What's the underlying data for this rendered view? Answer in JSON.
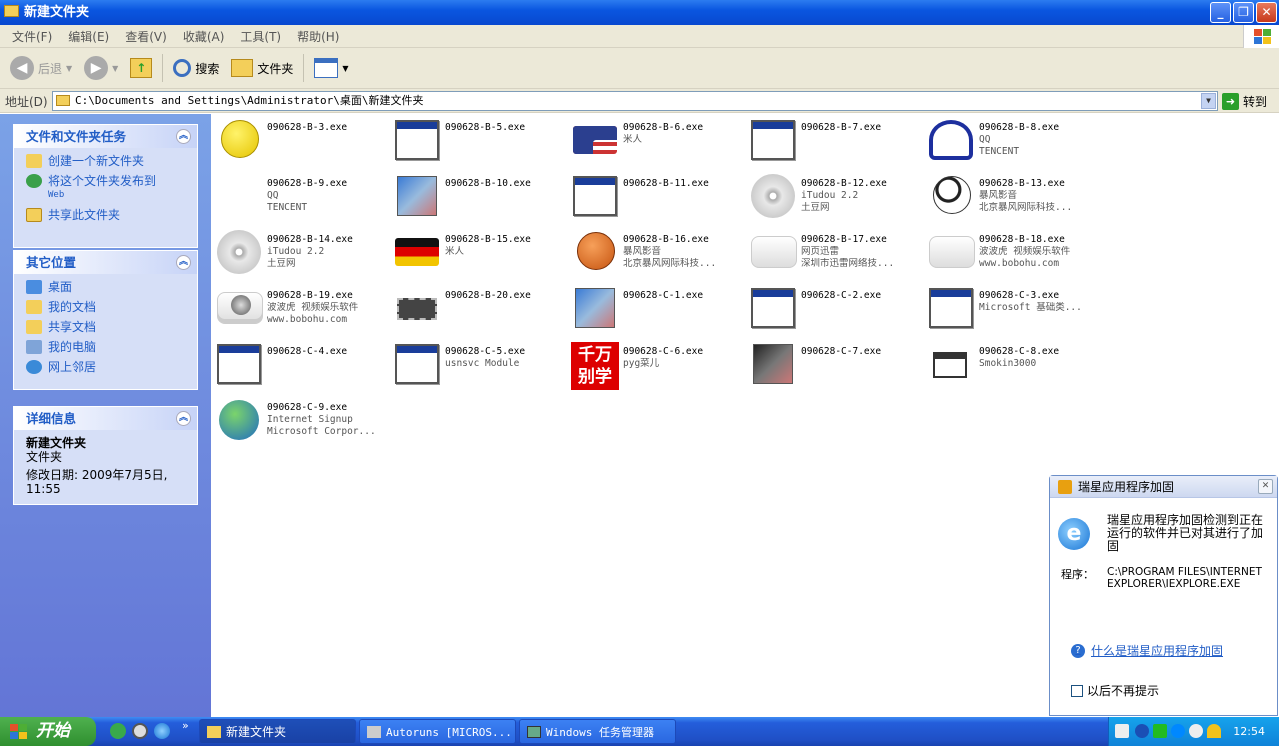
{
  "window": {
    "title": "新建文件夹",
    "btn_min": "_",
    "btn_max": "❐",
    "btn_close": "✕"
  },
  "menu": [
    "文件(F)",
    "编辑(E)",
    "查看(V)",
    "收藏(A)",
    "工具(T)",
    "帮助(H)"
  ],
  "toolbar": {
    "back": "后退",
    "search": "搜索",
    "folders": "文件夹"
  },
  "address": {
    "label": "地址(D)",
    "path": "C:\\Documents and Settings\\Administrator\\桌面\\新建文件夹",
    "go": "转到"
  },
  "tasks": {
    "title": "文件和文件夹任务",
    "items": [
      {
        "label": "创建一个新文件夹",
        "sub": ""
      },
      {
        "label": "将这个文件夹发布到",
        "sub": "Web"
      },
      {
        "label": "共享此文件夹",
        "sub": ""
      }
    ]
  },
  "places": {
    "title": "其它位置",
    "items": [
      "桌面",
      "我的文档",
      "共享文档",
      "我的电脑",
      "网上邻居"
    ]
  },
  "details": {
    "title": "详细信息",
    "name": "新建文件夹",
    "type": "文件夹",
    "modified": "修改日期: 2009年7月5日, 11:55"
  },
  "files": [
    {
      "name": "090628-B-3.exe",
      "desc": "",
      "comp": "",
      "icon": "smiley-icon"
    },
    {
      "name": "090628-B-5.exe",
      "desc": "",
      "comp": "",
      "icon": "window-icon"
    },
    {
      "name": "090628-B-6.exe",
      "desc": "米人",
      "comp": "",
      "icon": "us-flag-icon"
    },
    {
      "name": "090628-B-7.exe",
      "desc": "",
      "comp": "",
      "icon": "window-icon"
    },
    {
      "name": "090628-B-8.exe",
      "desc": "QQ",
      "comp": "TENCENT",
      "icon": "realtek-crab-icon"
    },
    {
      "name": "090628-B-9.exe",
      "desc": "QQ",
      "comp": "TENCENT",
      "icon": "blank-icon"
    },
    {
      "name": "090628-B-10.exe",
      "desc": "",
      "comp": "",
      "icon": "setup-icon"
    },
    {
      "name": "090628-B-11.exe",
      "desc": "",
      "comp": "",
      "icon": "window-icon"
    },
    {
      "name": "090628-B-12.exe",
      "desc": "iTudou 2.2",
      "comp": "土豆网",
      "icon": "disc-icon"
    },
    {
      "name": "090628-B-13.exe",
      "desc": "暴风影音",
      "comp": "北京暴风网际科技...",
      "icon": "soccer-ball-icon"
    },
    {
      "name": "090628-B-14.exe",
      "desc": "iTudou 2.2",
      "comp": "土豆网",
      "icon": "disc-icon"
    },
    {
      "name": "090628-B-15.exe",
      "desc": "米人",
      "comp": "",
      "icon": "german-flag-icon"
    },
    {
      "name": "090628-B-16.exe",
      "desc": "暴风影音",
      "comp": "北京暴风网际科技...",
      "icon": "basketball-icon"
    },
    {
      "name": "090628-B-17.exe",
      "desc": "网页迅雷",
      "comp": "深圳市迅雷网络技...",
      "icon": "white-box-icon"
    },
    {
      "name": "090628-B-18.exe",
      "desc": "波波虎 视频娱乐软件",
      "comp": "www.bobohu.com",
      "icon": "white-box-icon"
    },
    {
      "name": "090628-B-19.exe",
      "desc": "波波虎 视频娱乐软件",
      "comp": "www.bobohu.com",
      "icon": "globe-box-icon"
    },
    {
      "name": "090628-B-20.exe",
      "desc": "",
      "comp": "",
      "icon": "chip-icon"
    },
    {
      "name": "090628-C-1.exe",
      "desc": "",
      "comp": "",
      "icon": "setup-icon"
    },
    {
      "name": "090628-C-2.exe",
      "desc": "",
      "comp": "",
      "icon": "window-icon"
    },
    {
      "name": "090628-C-3.exe",
      "desc": "Microsoft 基础类...",
      "comp": "",
      "icon": "window-icon"
    },
    {
      "name": "090628-C-4.exe",
      "desc": "",
      "comp": "",
      "icon": "window-icon"
    },
    {
      "name": "090628-C-5.exe",
      "desc": "usnsvc Module",
      "comp": "",
      "icon": "window-icon"
    },
    {
      "name": "090628-C-6.exe",
      "desc": "pyg菜儿",
      "comp": "",
      "icon": "text-logo-icon"
    },
    {
      "name": "090628-C-7.exe",
      "desc": "",
      "comp": "",
      "icon": "setup-icon"
    },
    {
      "name": "090628-C-8.exe",
      "desc": "Smokin3000",
      "comp": "",
      "icon": "small-window-icon"
    },
    {
      "name": "090628-C-9.exe",
      "desc": "Internet Signup",
      "comp": "Microsoft Corpor...",
      "icon": "globe-computer-icon"
    }
  ],
  "file_logo_text": "千万别学",
  "popup": {
    "title": "瑞星应用程序加固",
    "message": "瑞星应用程序加固检测到正在运行的软件并已对其进行了加固",
    "program_label": "程序：",
    "program_path": "C:\\PROGRAM FILES\\INTERNET EXPLORER\\IEXPLORE.EXE",
    "help_link": "什么是瑞星应用程序加固",
    "dont_show": "以后不再提示"
  },
  "taskbar": {
    "start": "开始",
    "chevron": "»",
    "buttons": [
      "新建文件夹",
      "Autoruns [MICROS...",
      "Windows 任务管理器"
    ],
    "clock": "12:54"
  }
}
